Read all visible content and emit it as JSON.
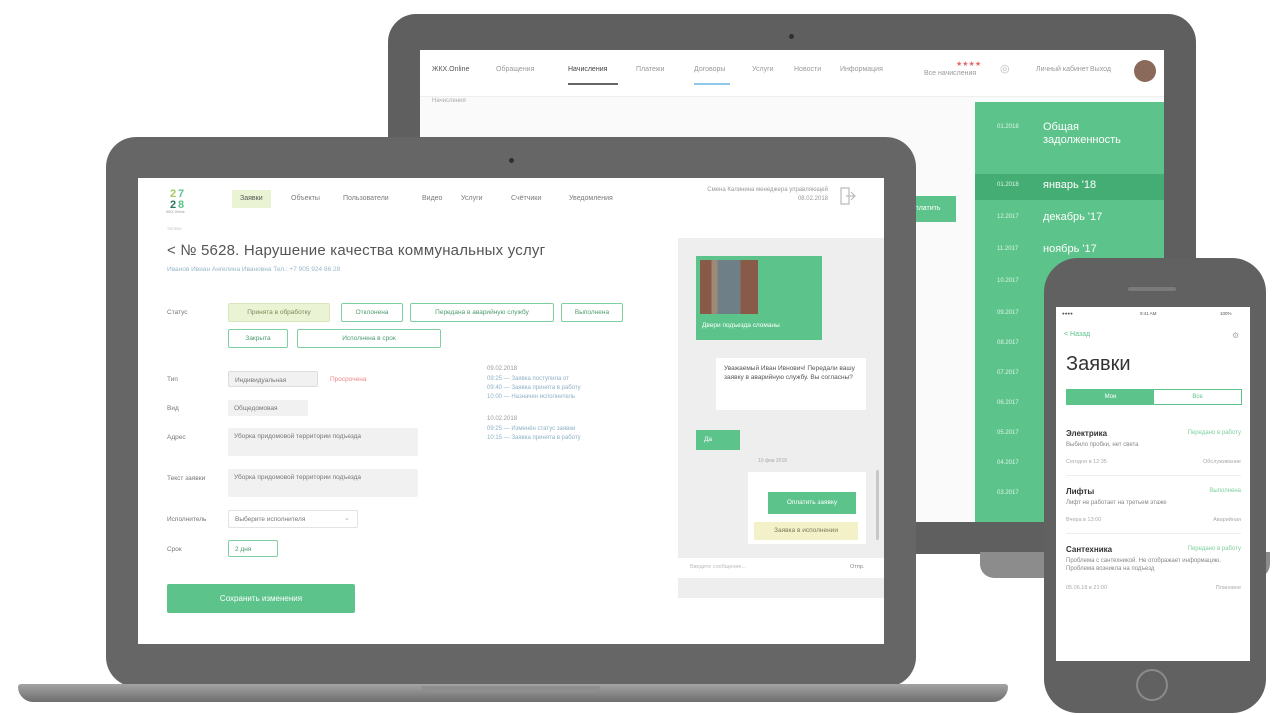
{
  "back_app": {
    "logo": "ЖКХ.Online",
    "nav": [
      "Обращения",
      "Начисления",
      "Платежи",
      "Договоры",
      "Услуги",
      "Новости",
      "Информация"
    ],
    "breadcrumb": "Начисления",
    "rating": "★★★★",
    "rating_label": "Все начисления",
    "user_button": "Личный кабинет",
    "logout": "Выход",
    "action_button": "Оплатить",
    "sidebar": [
      {
        "date": "01.2018",
        "label": "Общая задолженность"
      },
      {
        "date": "01.2018",
        "label": "январь '18"
      },
      {
        "date": "12.2017",
        "label": "декабрь '17"
      },
      {
        "date": "11.2017",
        "label": "ноябрь '17"
      },
      {
        "date": "10.2017",
        "label": ""
      },
      {
        "date": "09.2017",
        "label": ""
      },
      {
        "date": "08.2017",
        "label": ""
      },
      {
        "date": "07.2017",
        "label": ""
      },
      {
        "date": "06.2017",
        "label": ""
      },
      {
        "date": "05.2017",
        "label": ""
      },
      {
        "date": "04.2017",
        "label": ""
      },
      {
        "date": "03.2017",
        "label": ""
      }
    ]
  },
  "front_app": {
    "logo_text": "ЖКХ.Online",
    "tabs": [
      "Заявки",
      "Объекты",
      "Пользователи",
      "Видео",
      "Услуги",
      "Счётчики",
      "Уведомления"
    ],
    "header_info": "Смена Калинина менеджера управляющей\n08.02.2018",
    "exit_icon": "exit-icon",
    "title": "< № 5628. Нарушение качества коммунальных услуг",
    "subline": "Иванов Ивиан   Ангелина Ивановна   Тел.: +7 905 924 86 28",
    "status_label": "Статус",
    "statuses": [
      "Принята в обработку",
      "Отклонена",
      "Передана в аварийную службу",
      "Выполнена",
      "Закрыта",
      "Исполнена в срок"
    ],
    "form": [
      {
        "label": "Тип",
        "value": "Индивидуальная",
        "extra": "Просрочена"
      },
      {
        "label": "Вид",
        "value": "Общедомовая"
      },
      {
        "label": "Адрес",
        "value": "Уборка придомовой территории подъезда"
      },
      {
        "label": "Текст заявки",
        "value": "Уборка придомовой территории подъезда"
      },
      {
        "label": "Исполнитель",
        "value": "Выберите исполнителя"
      },
      {
        "label": "Срок",
        "value": "2 дня"
      }
    ],
    "history": [
      "09.02.2018",
      "09:25 — Заявка поступила от",
      "09:40 — Заявка принята в работу",
      "10:00 — Назначен исполнитель",
      "10.02.2018",
      "09:25 — Изменён статус заявки",
      "10:15 — Заявка принята в работу"
    ],
    "save_button": "Сохранить изменения",
    "chat": {
      "photo_caption": "Двери подъезда сломаны",
      "msg_white": "Уважаемый Иван Ивнович! Передали вашу заявку в аварийную службу. Вы согласны?",
      "msg_green_short": "Да",
      "timestamp": "10 фев 2018",
      "btn_confirm": "Оплатить заявку",
      "btn_in_progress": "Заявка в исполнении",
      "input_placeholder": "Введите сообщение...",
      "send": "Отпр."
    }
  },
  "phone_app": {
    "status_left": "●●●●",
    "status_time": "9:41 AM",
    "status_right": "100%",
    "back_label": "< Назад",
    "title": "Заявки",
    "segments": [
      "Мои",
      "Все"
    ],
    "requests": [
      {
        "title": "Электрика",
        "status": "Передано в работу",
        "body": "Выбило пробки, нет света",
        "date": "Сегодня в 12:35",
        "type": "Обслуживание"
      },
      {
        "title": "Лифты",
        "status": "Выполнена",
        "body": "Лифт не работает на третьем этаже",
        "date": "Вчера в 13:00",
        "type": "Аварийная"
      },
      {
        "title": "Сантехника",
        "status": "Передано в работу",
        "body": "Проблема с сантехникой. Не отображает информацию. Проблема возникла на подъезд",
        "date": "05.06.18 в 21:00",
        "type": "Плановое"
      }
    ]
  },
  "colors": {
    "accent_green": "#5cc38a",
    "selected_tab": "#eaf4d4",
    "device_gray": "#616161"
  }
}
